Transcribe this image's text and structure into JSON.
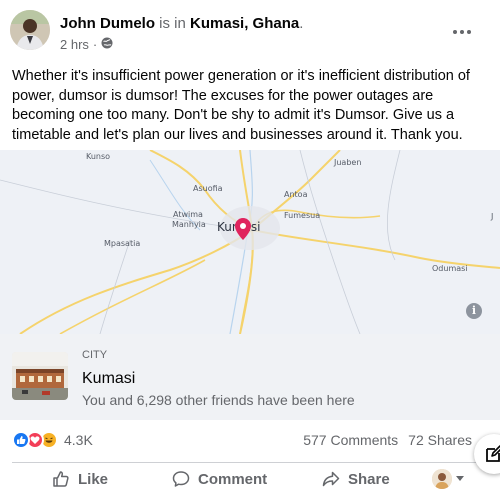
{
  "post": {
    "author_name": "John Dumelo",
    "is_in_text": " is in ",
    "place": "Kumasi, Ghana",
    "place_suffix": ".",
    "time": "2 hrs",
    "separator": "·",
    "privacy_icon": "globe-icon",
    "text": "Whether it's insufficient power generation or it's inefficient distribution of power, dumsor is dumsor! The excuses for the power outages are becoming one too many. Don't be shy to admit it's Dumsor. Give us a timetable and let's plan our lives and businesses around it. Thank you."
  },
  "map": {
    "labels": [
      "Kunso",
      "Juaben",
      "Asuofia",
      "Antoa",
      "Atwima",
      "Manhyia",
      "Fumesua",
      "Mpasatia",
      "Odumasi",
      "J"
    ],
    "city": "Kumasi",
    "marker_color": "#e0245e",
    "info_label": "i"
  },
  "place_card": {
    "category": "City",
    "name": "Kumasi",
    "visits": "You and 6,298 other friends have been here"
  },
  "engagement": {
    "reaction_icons": [
      "like-reaction-icon",
      "love-reaction-icon",
      "haha-reaction-icon"
    ],
    "reactions_count": "4.3K",
    "comments": "577 Comments",
    "shares": "72 Shares"
  },
  "actions": {
    "like": "Like",
    "comment": "Comment",
    "share": "Share"
  },
  "colors": {
    "accent": "#1877f2",
    "love": "#f33e58",
    "haha": "#f7b125",
    "muted_text": "#65676b",
    "map_bg": "#eef1f6",
    "road": "#f5d36c"
  }
}
